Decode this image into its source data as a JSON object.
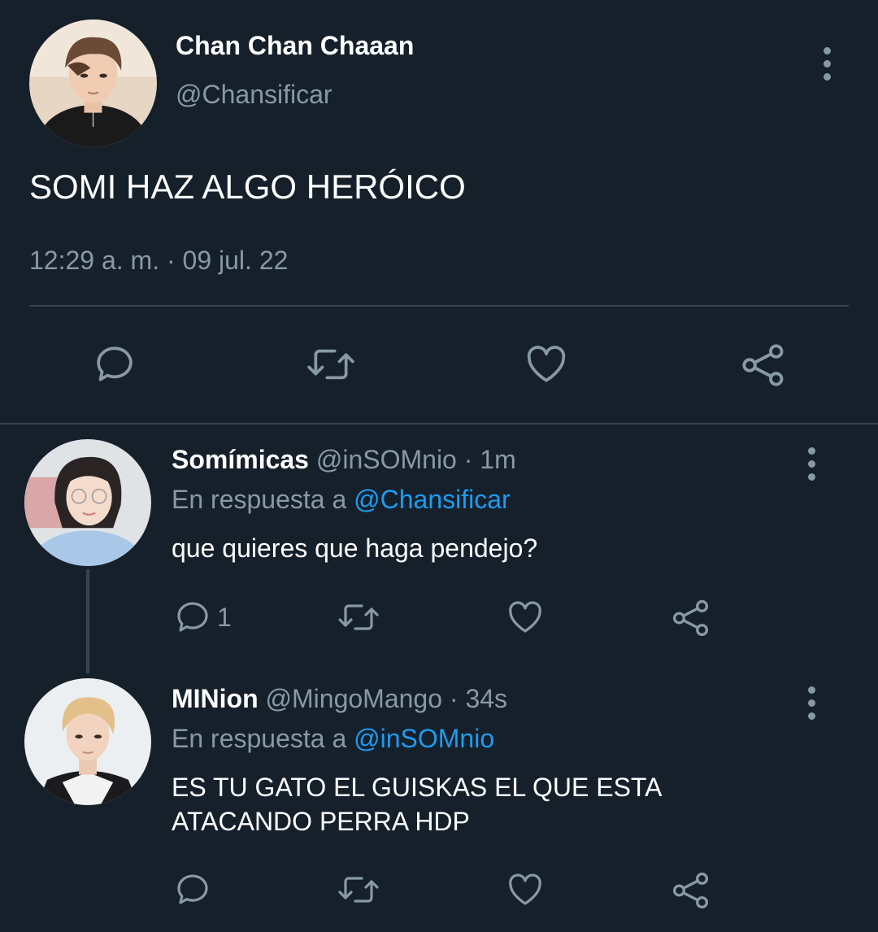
{
  "main_tweet": {
    "display_name": "Chan Chan Chaaan",
    "handle": "@Chansificar",
    "text": "SOMI HAZ ALGO HERÓICO",
    "timestamp": "12:29 a. m. · 09 jul. 22"
  },
  "replies": [
    {
      "display_name": "Somímicas",
      "handle": "@inSOMnio",
      "time": "· 1m",
      "reply_prefix": "En respuesta a",
      "reply_to": "@Chansificar",
      "text": "que quieres que haga pendejo?",
      "reply_count": "1"
    },
    {
      "display_name": "MINion",
      "handle": "@MingoMango",
      "time": "· 34s",
      "reply_prefix": "En respuesta a",
      "reply_to": "@inSOMnio",
      "text_line1": "ES TU GATO EL GUISKAS EL QUE ESTA",
      "text_line2": "ATACANDO PERRA HDP",
      "reply_count": ""
    }
  ],
  "icons": [
    "reply-icon",
    "retweet-icon",
    "like-icon",
    "share-icon",
    "more-icon"
  ],
  "colors": {
    "background": "#15202b",
    "muted": "#8899a6",
    "link": "#1d9bf0",
    "divider": "#38444d"
  }
}
